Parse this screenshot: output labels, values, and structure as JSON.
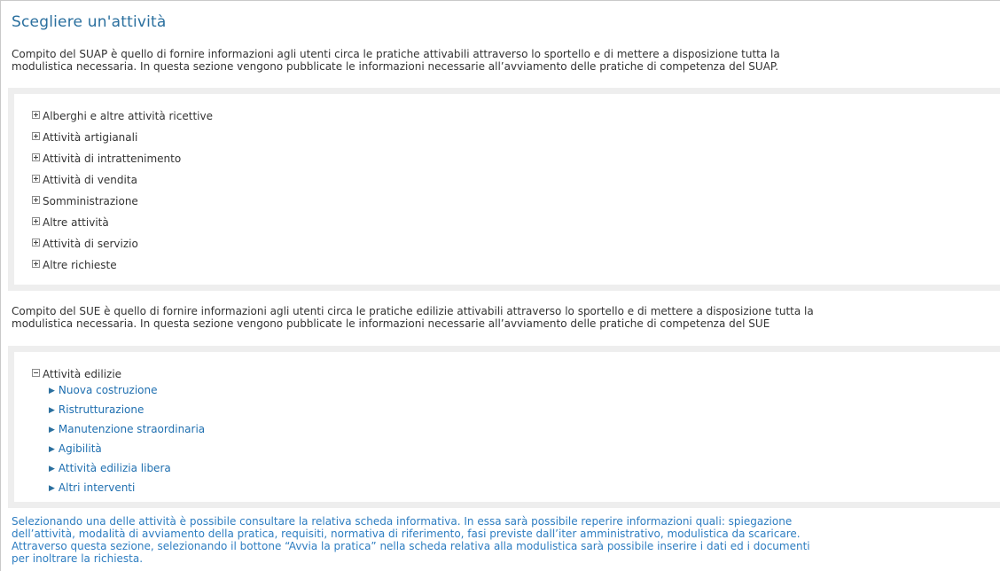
{
  "title": "Scegliere un'attività",
  "suap": {
    "intro_line1": "Compito del SUAP è quello di fornire informazioni agli utenti circa le pratiche attivabili attraverso lo sportello e di mettere a disposizione tutta la",
    "intro_line2": "modulistica necessaria. In questa sezione vengono pubblicate le informazioni necessarie all’avviamento delle pratiche di competenza del SUAP.",
    "categories": [
      {
        "label": "Alberghi e altre attività ricettive",
        "state": "collapsed"
      },
      {
        "label": "Attività artigianali",
        "state": "collapsed"
      },
      {
        "label": "Attività di intrattenimento",
        "state": "collapsed"
      },
      {
        "label": "Attività di vendita",
        "state": "collapsed"
      },
      {
        "label": "Somministrazione",
        "state": "collapsed"
      },
      {
        "label": "Altre attività",
        "state": "collapsed"
      },
      {
        "label": "Attività di servizio",
        "state": "collapsed"
      },
      {
        "label": "Altre richieste",
        "state": "collapsed"
      }
    ]
  },
  "sue": {
    "intro_line1": "Compito del SUE è quello di fornire informazioni agli utenti circa le pratiche edilizie attivabili attraverso lo sportello e di mettere a disposizione tutta la",
    "intro_line2": "modulistica necessaria. In questa sezione vengono pubblicate le informazioni necessarie all’avviamento delle pratiche di competenza del SUE",
    "category": {
      "label": "Attività edilizie",
      "state": "expanded",
      "items": [
        "Nuova costruzione",
        "Ristrutturazione",
        "Manutenzione straordinaria",
        "Agibilità",
        "Attività edilizia libera",
        "Altri interventi"
      ]
    }
  },
  "footer": {
    "line1": "Selezionando una delle attività è possibile consultare la relativa scheda informativa. In essa sarà possibile reperire informazioni quali: spiegazione",
    "line2": "dell’attività, modalità di avviamento della pratica, requisiti, normativa di riferimento, fasi previste dall’iter amministrativo, modulistica da scaricare.",
    "line3": "Attraverso questa sezione, selezionando il bottone “Avvia la pratica” nella scheda relativa alla modulistica sarà possibile inserire i dati ed i documenti",
    "line4": "per inoltrare la richiesta."
  },
  "colors": {
    "title": "#2a6f9e",
    "link": "#1f6fb0",
    "footer_text": "#2d7dc1",
    "panel_border": "#eeeeee"
  },
  "icons": {
    "collapsed": "plus-box-icon",
    "expanded": "minus-box-icon",
    "item": "triangle-right-icon"
  }
}
